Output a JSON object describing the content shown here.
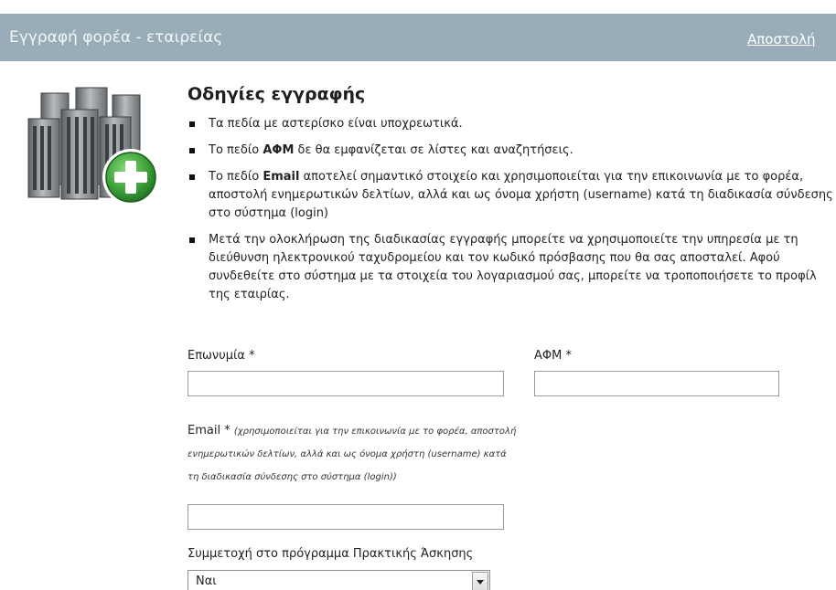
{
  "header": {
    "title": "Εγγραφή φορέα - εταιρείας",
    "link_label": "Αποστολή"
  },
  "instructions": {
    "title": "Οδηγίες εγγραφής",
    "items": [
      {
        "text": "Τα πεδία με αστερίσκο είναι υποχρεωτικά."
      },
      {
        "pre": "Το πεδίο ",
        "bold": "ΑΦΜ",
        "post": " δε θα εμφανίζεται σε λίστες και αναζητήσεις."
      },
      {
        "pre": "Το πεδίο ",
        "bold": "Email",
        "post": " αποτελεί σημαντικό στοιχείο και χρησιμοποιείται για την επικοινωνία με το φορέα, αποστολή ενημερωτικών δελτίων, αλλά και ως όνομα χρήστη (username) κατά τη διαδικασία σύνδεσης στο σύστημα (login)"
      },
      {
        "text": "Μετά την ολοκλήρωση της διαδικασίας εγγραφής μπορείτε να χρησιμοποιείτε την υπηρεσία με τη διεύθυνση ηλεκτρονικού ταχυδρομείου και τον κωδικό πρόσβασης που θα σας αποσταλεί. Αφού συνδεθείτε στο σύστημα με τα στοιχεία του λογαριασμού σας, μπορείτε να τροποποιήσετε το προφίλ της εταιρίας."
      }
    ]
  },
  "form": {
    "name_label": "Επωνυμία *",
    "name_value": "",
    "afm_label": "ΑΦΜ *",
    "afm_value": "",
    "email_label": "Email *",
    "email_hint": "(χρησιμοποιείται για την επικοινωνία με το φορέα, αποστολή ενημερωτικών δελτίων, αλλά και ως όνομα χρήστη (username) κατά τη διαδικασία σύνδεσης στο σύστημα (login))",
    "email_value": "",
    "participation_label": "Συμμετοχή στο πρόγραμμα Πρακτικής Άσκησης",
    "participation_value": "Ναι"
  },
  "icons": {
    "logo": "company-buildings-add-icon",
    "dropdown": "chevron-down-icon"
  },
  "colors": {
    "header_bg": "#99adb8",
    "plus_green": "#3fa33a"
  }
}
